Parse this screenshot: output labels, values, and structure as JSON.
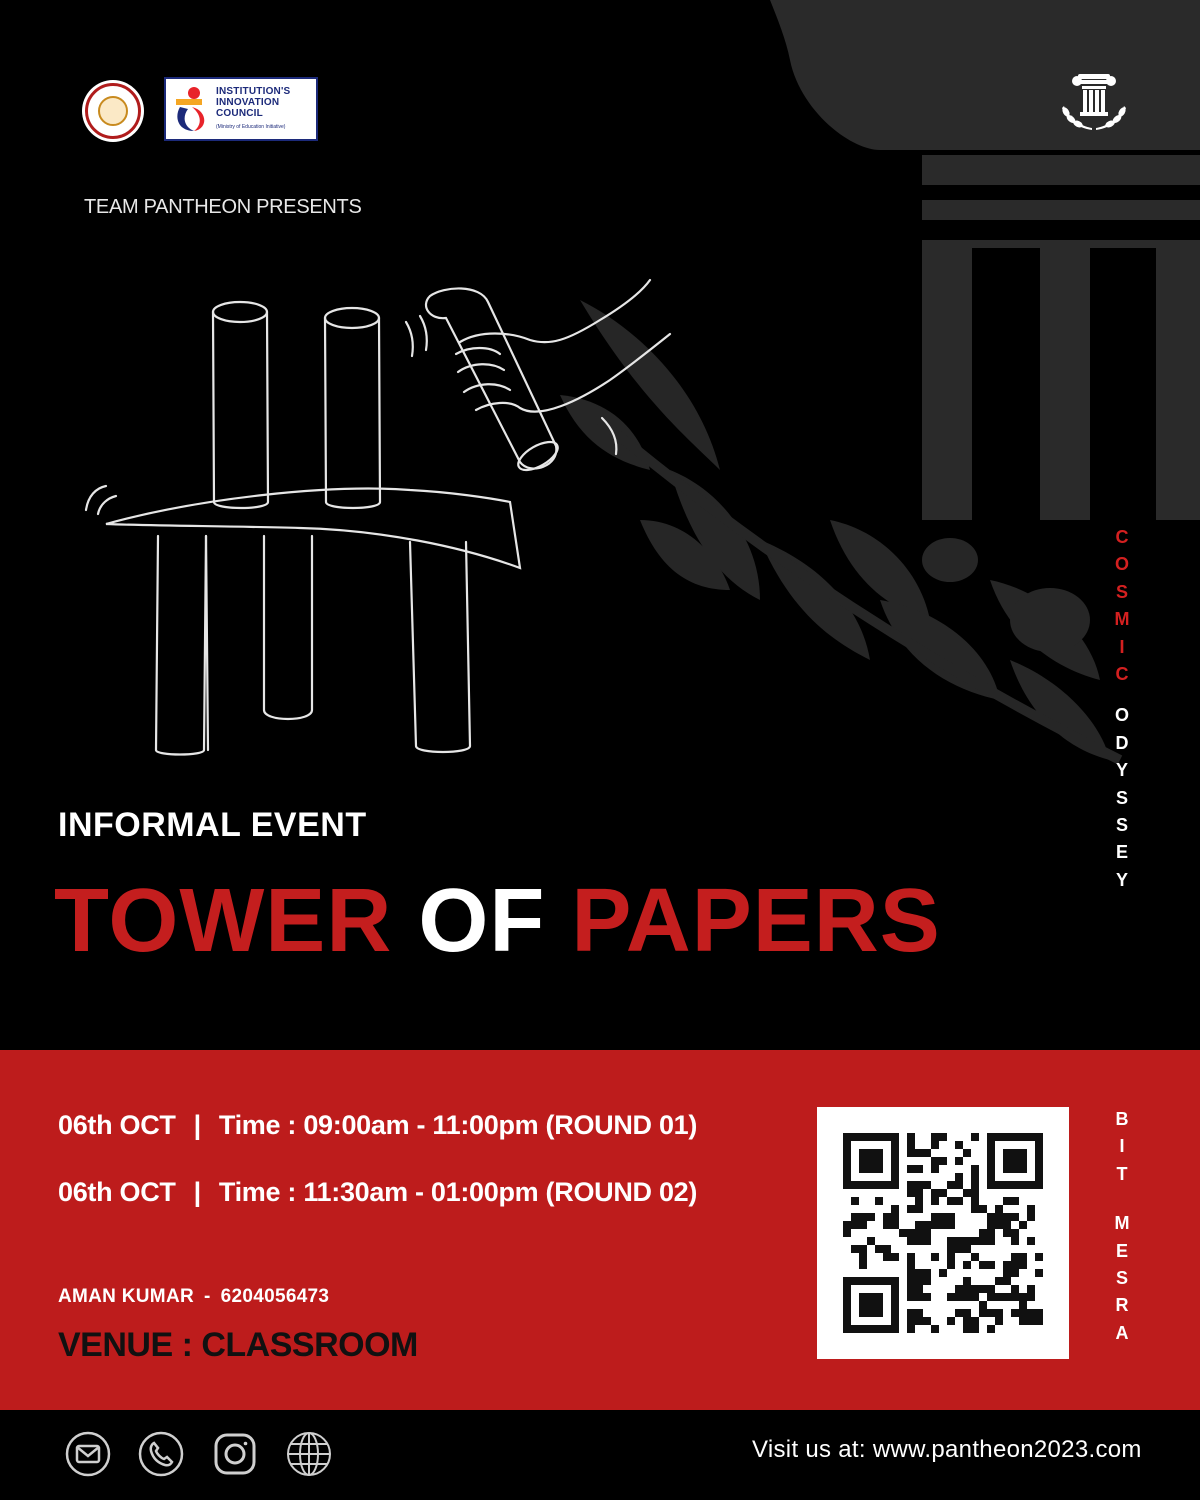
{
  "header": {
    "presents": "TEAM PANTHEON PRESENTS",
    "iic_logo": {
      "line1": "INSTITUTION'S",
      "line2": "INNOVATION",
      "line3": "COUNCIL",
      "sub": "(Ministry of Education Initiative)"
    }
  },
  "side_brand": {
    "word1": [
      "C",
      "O",
      "S",
      "M",
      "I",
      "C"
    ],
    "word2": [
      "O",
      "D",
      "Y",
      "S",
      "S",
      "E",
      "Y"
    ]
  },
  "event": {
    "category": "INFORMAL EVENT",
    "title_part1": "TOWER",
    "title_part2": "OF",
    "title_part3": "PAPERS"
  },
  "schedule": [
    {
      "date": "06th OCT",
      "separator": "|",
      "time": "Time : 09:00am - 11:00pm (ROUND 01)"
    },
    {
      "date": "06th OCT",
      "separator": "|",
      "time": "Time : 11:30am - 01:00pm (ROUND 02)"
    }
  ],
  "contact": {
    "name": "AMAN KUMAR",
    "dash": "-",
    "phone": "6204056473"
  },
  "venue": "VENUE : CLASSROOM",
  "bit_vertical": {
    "word1": [
      "B",
      "I",
      "T"
    ],
    "word2": [
      "M",
      "E",
      "S",
      "R",
      "A"
    ]
  },
  "footer": {
    "visit": "Visit us at: www.pantheon2023.com",
    "icons": [
      "mail-icon",
      "phone-icon",
      "instagram-icon",
      "globe-icon"
    ]
  },
  "colors": {
    "background": "#000000",
    "accent_red": "#c41e1e",
    "band_red": "#bd1c1c",
    "text_white": "#ffffff"
  }
}
